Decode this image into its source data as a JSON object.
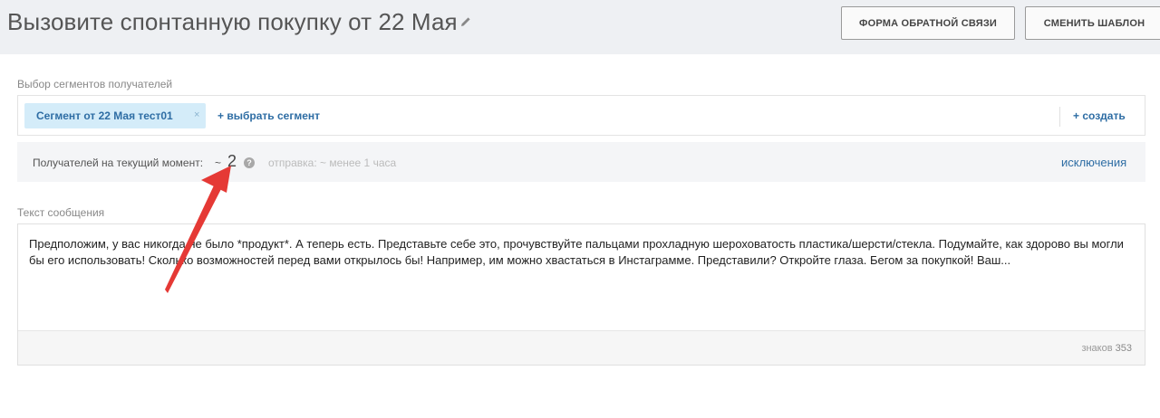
{
  "header": {
    "title": "Вызовите спонтанную покупку от 22 Мая",
    "feedback_button": "ФОРМА ОБРАТНОЙ СВЯЗИ",
    "change_template_button": "СМЕНИТЬ ШАБЛОН"
  },
  "segments": {
    "label": "Выбор сегментов получателей",
    "selected": [
      "Сегмент от 22 Мая тест01"
    ],
    "remove_glyph": "×",
    "select_link": "+ выбрать сегмент",
    "create_link": "+ создать"
  },
  "recipients": {
    "label": "Получателей на текущий момент:",
    "tilde": "~",
    "count": "2",
    "help_glyph": "?",
    "send_time": "отправка: ~ менее 1 часа",
    "exclusions_link": "исключения"
  },
  "message": {
    "label": "Текст сообщения",
    "text": "Предположим, у вас никогда не было *продукт*. А теперь есть. Представьте себе это, прочувствуйте пальцами прохладную шероховатость пластика/шерсти/стекла. Подумайте, как здорово вы могли бы его использовать! Сколько возможностей перед вами открылось бы! Например, им можно хвастаться в Инстаграмме. Представили? Откройте глаза. Бегом за покупкой! Ваш...",
    "char_label": "знаков",
    "char_count": "353"
  },
  "colors": {
    "link": "#2e6da4",
    "chip_bg": "#d4ecf9",
    "annotation_arrow": "#e53935"
  }
}
